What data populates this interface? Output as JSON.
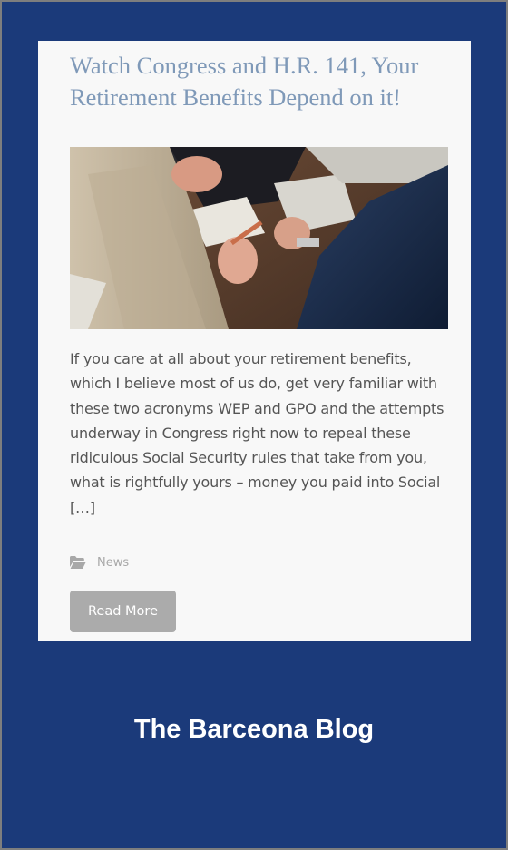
{
  "post": {
    "title": "Watch Congress and H.R. 141, Your Retirement Benefits Depend on it!",
    "image_icon": "business-meeting-photo",
    "excerpt": "If you care at all about your retirement benefits, which I believe most of us do, get very familiar with these two acronyms WEP and GPO and the attempts underway in Congress right now to repeal these ridiculous Social Security rules that take from you, what is rightfully yours – money you paid into Social […]",
    "category_icon": "folder-open-icon",
    "category": "News",
    "read_more_label": "Read More"
  },
  "footer": {
    "blog_title": "The Barceona Blog"
  },
  "colors": {
    "page_background": "#1b3a7a",
    "card_background": "#f8f8f8",
    "title_color": "#7f99b8",
    "button_background": "#ababab"
  }
}
